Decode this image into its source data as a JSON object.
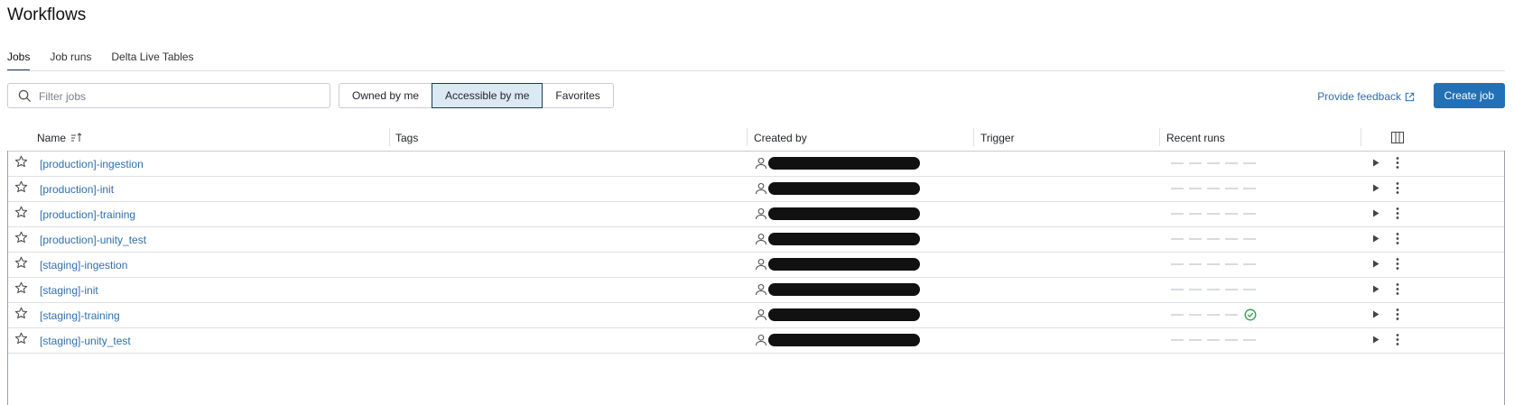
{
  "page": {
    "title": "Workflows"
  },
  "tabs": [
    {
      "label": "Jobs",
      "active": true
    },
    {
      "label": "Job runs",
      "active": false
    },
    {
      "label": "Delta Live Tables",
      "active": false
    }
  ],
  "toolbar": {
    "search_placeholder": "Filter jobs",
    "filters": [
      {
        "label": "Owned by me",
        "selected": false
      },
      {
        "label": "Accessible by me",
        "selected": true
      },
      {
        "label": "Favorites",
        "selected": false
      }
    ],
    "feedback_label": "Provide feedback",
    "create_label": "Create job"
  },
  "table": {
    "columns": {
      "name": "Name",
      "tags": "Tags",
      "created_by": "Created by",
      "trigger": "Trigger",
      "recent_runs": "Recent runs"
    },
    "rows": [
      {
        "name": "[production]-ingestion",
        "last_run": ""
      },
      {
        "name": "[production]-init",
        "last_run": ""
      },
      {
        "name": "[production]-training",
        "last_run": ""
      },
      {
        "name": "[production]-unity_test",
        "last_run": ""
      },
      {
        "name": "[staging]-ingestion",
        "last_run": ""
      },
      {
        "name": "[staging]-init",
        "last_run": ""
      },
      {
        "name": "[staging]-training",
        "last_run": "success"
      },
      {
        "name": "[staging]-unity_test",
        "last_run": ""
      }
    ]
  },
  "colors": {
    "accent": "#2270b6",
    "link": "#2f6fad",
    "success": "#2e9a4a",
    "selected_bg": "#dbe9f5"
  },
  "icons": [
    "search-icon",
    "external-link-icon",
    "sort-ascending-icon",
    "columns-icon",
    "star-icon",
    "user-icon",
    "check-circle-icon",
    "play-icon",
    "kebab-menu-icon"
  ]
}
